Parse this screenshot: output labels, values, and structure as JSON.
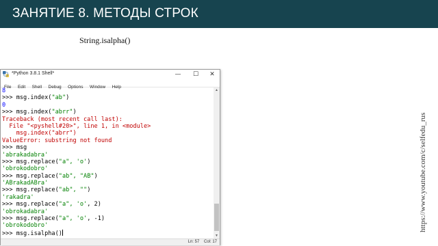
{
  "header": {
    "title": "ЗАНЯТИЕ 8. МЕТОДЫ СТРОК"
  },
  "subtitle": "String.isalpha()",
  "side_url": "https://www.youtube.com/c/selfedu_rus",
  "window": {
    "title": "*Python 3.8.1 Shell*",
    "buttons": {
      "minimize": "—",
      "maximize": "☐",
      "close": "✕"
    },
    "menu": [
      "File",
      "Edit",
      "Shell",
      "Debug",
      "Options",
      "Window",
      "Help"
    ],
    "status": {
      "ln": "Ln: 57",
      "col": "Col: 17"
    }
  },
  "shell": {
    "lines": [
      {
        "kind": "out",
        "text": "8"
      },
      {
        "kind": "cmd",
        "pre": ">>> msg.index(",
        "str": "\"ab\"",
        "post": ")"
      },
      {
        "kind": "out",
        "text": "0"
      },
      {
        "kind": "cmd",
        "pre": ">>> msg.index(",
        "str": "\"abrr\"",
        "post": ")"
      },
      {
        "kind": "err",
        "text": "Traceback (most recent call last):"
      },
      {
        "kind": "err",
        "text": "  File \"<pyshell#20>\", line 1, in <module>"
      },
      {
        "kind": "err",
        "text": "    msg.index(\"abrr\")"
      },
      {
        "kind": "err",
        "text": "ValueError: substring not found"
      },
      {
        "kind": "cmd",
        "pre": ">>> msg",
        "str": "",
        "post": ""
      },
      {
        "kind": "outstr",
        "text": "'abrakadabra'"
      },
      {
        "kind": "cmd",
        "pre": ">>> msg.replace(",
        "str": "\"a\", 'o'",
        "post": ")"
      },
      {
        "kind": "outstr",
        "text": "'obrokodobro'"
      },
      {
        "kind": "cmd",
        "pre": ">>> msg.replace(",
        "str": "\"ab\", \"AB\"",
        "post": ")"
      },
      {
        "kind": "outstr",
        "text": "'ABrakadABra'"
      },
      {
        "kind": "cmd",
        "pre": ">>> msg.replace(",
        "str": "\"ab\", \"\"",
        "post": ")"
      },
      {
        "kind": "outstr",
        "text": "'rakadra'"
      },
      {
        "kind": "cmd",
        "pre": ">>> msg.replace(",
        "str": "\"a\", 'o'",
        "post": ", 2)"
      },
      {
        "kind": "outstr",
        "text": "'obrokadabra'"
      },
      {
        "kind": "cmd",
        "pre": ">>> msg.replace(",
        "str": "\"a\", 'o'",
        "post": ", -1)"
      },
      {
        "kind": "outstr",
        "text": "'obrokodobro'"
      },
      {
        "kind": "cmd",
        "pre": ">>> msg.isalpha()",
        "str": "",
        "post": ""
      }
    ]
  },
  "colors": {
    "header_bg": "#17444f",
    "string": "#008000",
    "output": "#0000ff",
    "error": "#c00000"
  }
}
